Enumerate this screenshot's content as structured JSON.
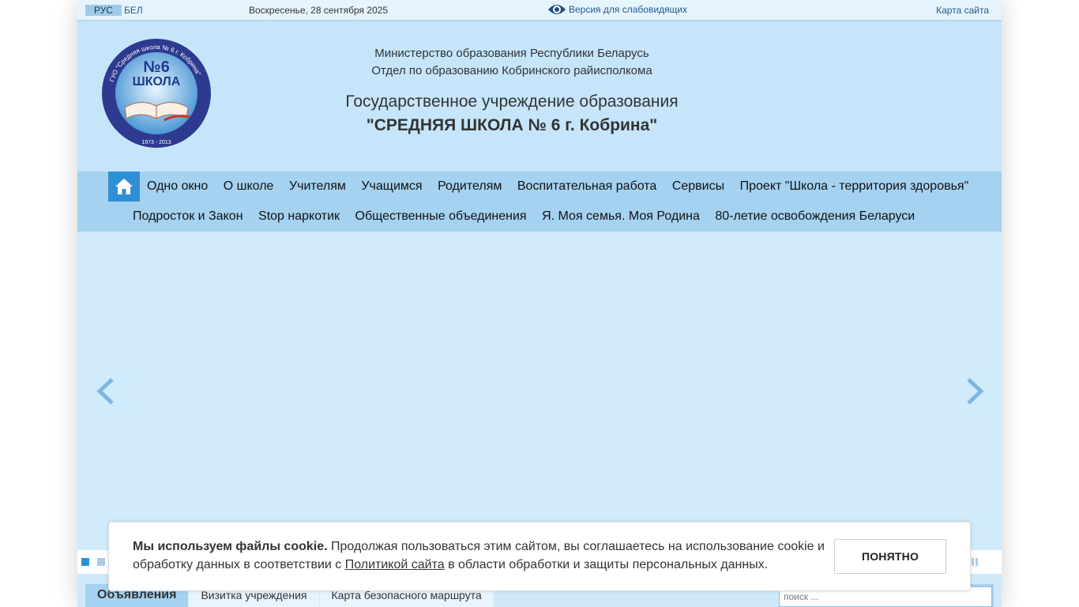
{
  "topbar": {
    "lang_ru": "РУС",
    "lang_be": "БЕЛ",
    "date": "Воскресенье, 28 сентября 2025",
    "vision_label": "Версия для слабовидящих",
    "sitemap_label": "Карта сайта"
  },
  "header": {
    "ministry_line1": "Министерство образования Республики Беларусь",
    "ministry_line2": "Отдел по образованию Кобринского райисполкома",
    "inst_line1": "Государственное учреждение образования",
    "inst_line2": "\"СРЕДНЯЯ ШКОЛА № 6 г. Кобрина\"",
    "logo": {
      "ring_text": "ГУО \"Средняя школа № 6 г. Кобрина\"",
      "number": "№6",
      "word": "ШКОЛА",
      "years": "1973 - 2013"
    }
  },
  "nav": {
    "home_icon": "home-icon",
    "row1": [
      "Одно окно",
      "О школе",
      "Учителям",
      "Учащимся",
      "Родителям",
      "Воспитательная работа",
      "Сервисы",
      "Проект \"Школа - территория здоровья\""
    ],
    "row2": [
      "Подросток и Закон",
      "Stop наркотик",
      "Общественные объединения",
      "Я. Моя семья. Моя Родина",
      "80-летие освобождения Беларуси"
    ]
  },
  "slider": {
    "prev_icon": "chevron-left-icon",
    "next_icon": "chevron-right-icon",
    "pause_icon": "pause-icon"
  },
  "tabs": [
    "Объявления",
    "Визитка учреждения",
    "Карта безопасного маршрута"
  ],
  "search": {
    "placeholder": "поиск ..."
  },
  "cookie": {
    "bold": "Мы используем файлы cookie.",
    "text1": " Продолжая пользоваться этим сайтом, вы соглашаетесь на использование cookie и обработку данных в соответствии с ",
    "link": "Политикой сайта",
    "text2": " в области обработки и защиты персональных данных.",
    "button": "ПОНЯТНО"
  },
  "colors": {
    "accent": "#2f8fd6",
    "nav_bg": "#a5d2f0",
    "header_bg": "#c6e5fb",
    "slider_bg": "#d0ebfc"
  }
}
